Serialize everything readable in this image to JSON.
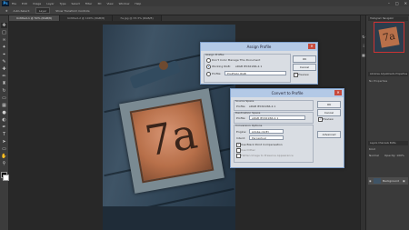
{
  "menubar": {
    "app_icon": "Ps",
    "items": [
      "File",
      "Edit",
      "Image",
      "Layer",
      "Type",
      "Select",
      "Filter",
      "3D",
      "View",
      "Window",
      "Help"
    ]
  },
  "options_bar": {
    "items": [
      "Auto-Select:",
      "Layer",
      "Show Transform Controls"
    ]
  },
  "tabs": [
    {
      "label": "Untitled-1 @ 50% (RGB/8)",
      "active": true
    },
    {
      "label": "Untitled-2 @ 100% (RGB/8)",
      "active": false
    },
    {
      "label": "7a.jpg @ 33.3% (RGB/8)",
      "active": false
    }
  ],
  "photo": {
    "digits": "7a"
  },
  "assign_profile": {
    "title": "Assign Profile",
    "section": "Assign Profile:",
    "option_dont": "Don't Color Manage This Document",
    "option_working": "Working RGB:",
    "working_value": "sRGB IEC61966-2.1",
    "option_profile": "Profile:",
    "profile_value": "ProPhoto RGB",
    "ok": "OK",
    "cancel": "Cancel",
    "preview": "Preview"
  },
  "convert_profile": {
    "title": "Convert to Profile",
    "source_title": "Source Space",
    "source_label": "Profile:",
    "source_value": "sRGB IEC61966-2.1",
    "dest_title": "Destination Space",
    "dest_label": "Profile:",
    "dest_value": "sRGB IEC61966-2.1",
    "conv_title": "Conversion Options",
    "engine_label": "Engine:",
    "engine_value": "Adobe (ACE)",
    "intent_label": "Intent:",
    "intent_value": "Perceptual",
    "bpc": "Use Black Point Compensation",
    "dither": "Use Dither",
    "flatten": "Flatten Image to Preserve Appearance",
    "ok": "OK",
    "cancel": "Cancel",
    "preview": "Preview",
    "advanced": "Advanced"
  },
  "right_panels": {
    "navigator_tabs": [
      "Histogram",
      "Navigator"
    ],
    "properties_tabs": [
      "Libraries",
      "Adjustments",
      "Properties"
    ],
    "properties_note": "No Properties",
    "layers_tabs": [
      "Layers",
      "Channels",
      "Paths"
    ],
    "kind": "Kind",
    "blend": "Normal",
    "opacity": "Opacity: 100%",
    "layer_name": "Background"
  }
}
